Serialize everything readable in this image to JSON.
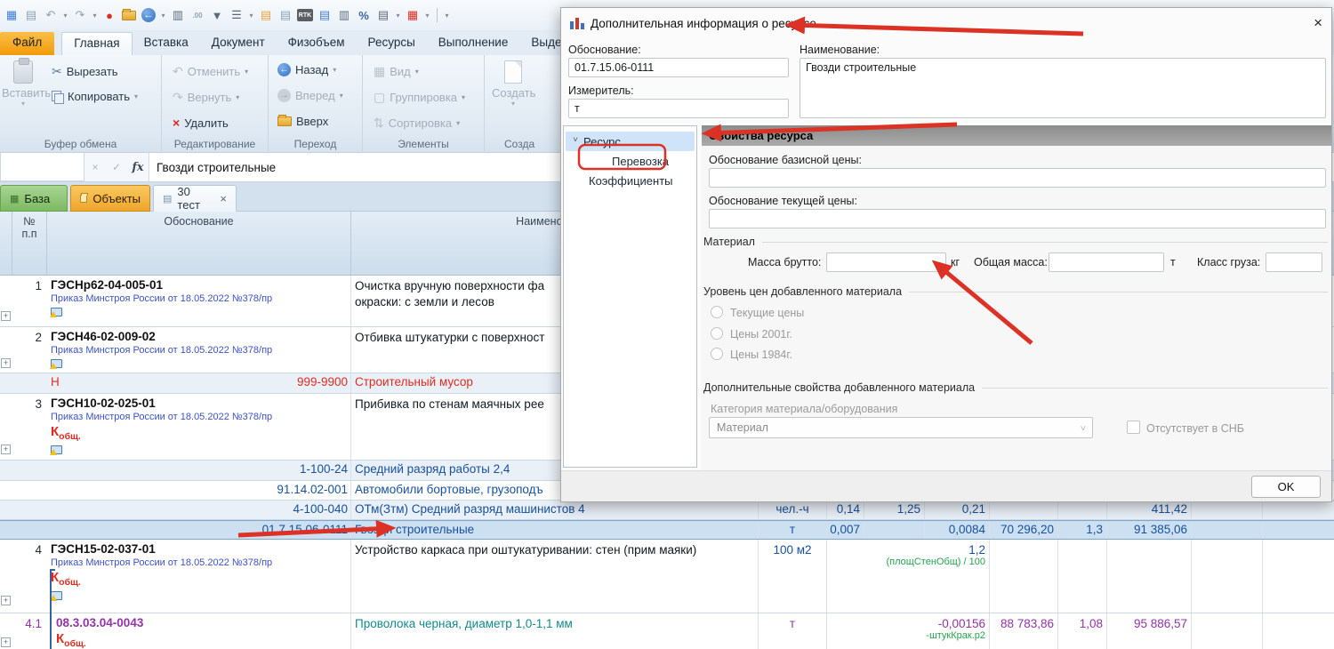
{
  "colors": {
    "annotation_red": "#dc3226",
    "selection_blue": "#cde0f2",
    "link_blue": "#3d52c4",
    "value_navy": "#17519e",
    "alert_red": "#e02b20",
    "resource_purple": "#9233a8",
    "resource_teal": "#12898a",
    "formula_green": "#23a24d",
    "file_tab_orange": "#f29a0b"
  },
  "quick_access": {
    "icons": [
      {
        "name": "app-icon",
        "glyph": "▦"
      },
      {
        "name": "save-icon",
        "glyph": "▤"
      },
      {
        "name": "undo-icon",
        "glyph": "↶"
      },
      {
        "name": "redo-icon",
        "glyph": "↷"
      },
      {
        "name": "pin-icon",
        "glyph": "●"
      },
      {
        "name": "folder-open-icon",
        "glyph": ""
      },
      {
        "name": "back-icon",
        "glyph": "←"
      },
      {
        "name": "print-preview-icon",
        "glyph": "▥"
      },
      {
        "name": "precision-icon",
        "glyph": ".00"
      },
      {
        "name": "filter-icon",
        "glyph": "▼"
      },
      {
        "name": "layout-icon",
        "glyph": "☰"
      },
      {
        "name": "doc-edit-icon",
        "glyph": "▤"
      },
      {
        "name": "doc-refresh-icon",
        "glyph": "▤"
      },
      {
        "name": "rtk-icon",
        "glyph": "RTK"
      },
      {
        "name": "doc-lines-icon",
        "glyph": "▤"
      },
      {
        "name": "doc-image-icon",
        "glyph": "▥"
      },
      {
        "name": "percent-icon",
        "glyph": "%"
      },
      {
        "name": "cells-icon",
        "glyph": "▤"
      },
      {
        "name": "table-add-icon",
        "glyph": "▦"
      },
      {
        "name": "overflow-icon",
        "glyph": "▾"
      }
    ],
    "caret": "▾"
  },
  "ribbon": {
    "tabs": [
      "Файл",
      "Главная",
      "Вставка",
      "Документ",
      "Физобъем",
      "Ресурсы",
      "Выполнение",
      "Выделе"
    ],
    "clipboard": {
      "label": "Буфер обмена",
      "paste": "Вставить",
      "cut": "Вырезать",
      "copy": "Копировать"
    },
    "editing": {
      "label": "Редактирование",
      "undo": "Отменить",
      "redo": "Вернуть",
      "delete": "Удалить"
    },
    "navigation": {
      "label": "Переход",
      "back": "Назад",
      "forward": "Вперед",
      "up": "Вверх"
    },
    "elements": {
      "label": "Элементы",
      "view": "Вид",
      "grouping": "Группировка",
      "sorting": "Сортировка"
    },
    "create": {
      "label": "Созда",
      "create": "Создать"
    }
  },
  "formula_bar": {
    "cancel": "×",
    "confirm": "✓",
    "fx": "fx",
    "value": "Гвозди строительные"
  },
  "doc_tabs": {
    "base": "База",
    "objects": "Объекты",
    "doc": "30 тест",
    "close": "×"
  },
  "grid": {
    "header": {
      "num1": "№",
      "num2": "п.п",
      "justification": "Обоснование",
      "name": "Наименование"
    },
    "r1": {
      "num": "1",
      "code": "ГЭСНр62-04-005-01",
      "order": "Приказ Минстроя России от 18.05.2022 №378/пр",
      "name1": "Очистка вручную поверхности фа",
      "name2": "окраски: с земли и лесов"
    },
    "r2": {
      "num": "2",
      "code": "ГЭСН46-02-009-02",
      "order": "Приказ Минстроя России от 18.05.2022 №378/пр",
      "name": "Отбивка штукатурки с поверхност"
    },
    "rh": {
      "mark": "Н",
      "code": "999-9900",
      "name": "Строительный мусор"
    },
    "r3": {
      "num": "3",
      "code": "ГЭСН10-02-025-01",
      "order": "Приказ Минстроя России от 18.05.2022 №378/пр",
      "k": "К",
      "ksub": "общ.",
      "name": "Прибивка по стенам маячных рее"
    },
    "s1": {
      "code": "1-100-24",
      "name": "Средний разряд работы 2,4"
    },
    "s2": {
      "code": "91.14.02-001",
      "name": "Автомобили бортовые, грузоподъ"
    },
    "s3": {
      "code": "4-100-040",
      "name": "ОТм(Зтм) Средний разряд машинистов 4",
      "unit": "чел.-ч",
      "c1": "0,14",
      "c2": "1,25",
      "c3": "0,21",
      "c6": "411,42"
    },
    "s4": {
      "code": "01.7.15.06-0111",
      "name": "Гвозди строительные",
      "unit": "т",
      "c1": "0,007",
      "c3": "0,0084",
      "c4": "70 296,20",
      "c5": "1,3",
      "c6": "91 385,06"
    },
    "r4": {
      "num": "4",
      "code": "ГЭСН15-02-037-01",
      "order": "Приказ Минстроя России от 18.05.2022 №378/пр",
      "k": "К",
      "ksub": "общ.",
      "name": "Устройство каркаса при оштукатуривании: стен (прим маяки)",
      "unit": "100 м2",
      "c3": "1,2",
      "formula": "(площСтенОбщ) / 100"
    },
    "r41": {
      "num": "4.1",
      "code": "08.3.03.04-0043",
      "k": "К",
      "ksub": "общ.",
      "name": "Проволока черная, диаметр 1,0-1,1 мм",
      "unit": "т",
      "c3": "-0,00156",
      "formula": "-штукКрак.р2",
      "c4": "88 783,86",
      "c5": "1,08",
      "c6": "95 886,57"
    }
  },
  "dialog": {
    "title": "Дополнительная информация о ресурсе",
    "close": "×",
    "justification_label": "Обоснование:",
    "justification_value": "01.7.15.06-0111",
    "name_label": "Наименование:",
    "name_value": "Гвозди строительные",
    "unit_label": "Измеритель:",
    "unit_value": "т",
    "tree": {
      "resource": "Ресурс",
      "transport": "Перевозка",
      "coefficients": "Коэффициенты"
    },
    "panel": {
      "header": "Свойства ресурса",
      "base_price_label": "Обоснование базисной цены:",
      "current_price_label": "Обоснование текущей цены:",
      "material_group": "Материал",
      "gross_mass_label": "Масса брутто:",
      "gross_mass_unit": "кг",
      "total_mass_label": "Общая масса:",
      "total_mass_unit": "т",
      "cargo_class_label": "Класс груза:",
      "price_level_group": "Уровень цен добавленного материала",
      "radio1": "Текущие цены",
      "radio2": "Цены 2001г.",
      "radio3": "Цены 1984г.",
      "extra_group": "Дополнительные свойства добавленного материала",
      "category_label": "Категория материала/оборудования",
      "category_value": "Материал",
      "checkbox_label": "Отсутствует в СНБ",
      "ok": "OK"
    }
  },
  "annotations": {
    "color": "#dc3226",
    "arrows": [
      "dialog-title",
      "tree-resource-item",
      "mass-brutto-field",
      "selected-resource-row"
    ],
    "highlight_box_target": "Перевозка"
  }
}
